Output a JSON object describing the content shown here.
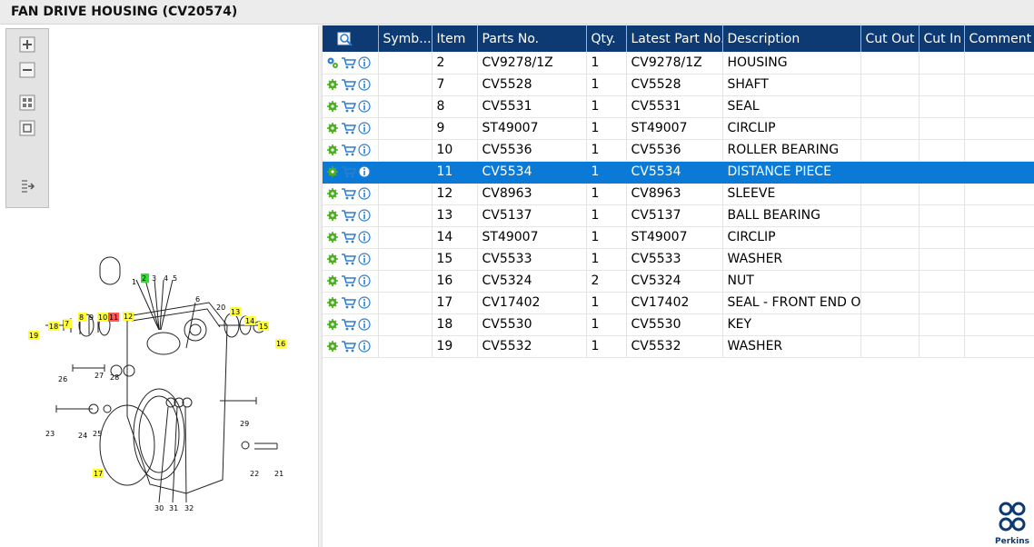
{
  "window": {
    "title": "FAN DRIVE HOUSING (CV20574)"
  },
  "toolbar": {
    "buttons": [
      {
        "name": "zoom-in",
        "icon": "zoom-in-icon"
      },
      {
        "name": "zoom-out",
        "icon": "zoom-out-icon"
      },
      {
        "name": "fit-all",
        "icon": "fit-all-icon"
      },
      {
        "name": "fit-window",
        "icon": "fit-window-icon"
      },
      {
        "name": "export",
        "icon": "export-icon"
      }
    ]
  },
  "grid": {
    "columns": [
      "Symb...",
      "Item",
      "Parts No.",
      "Qty.",
      "Latest Part No.",
      "Description",
      "Cut Out",
      "Cut In",
      "Comment"
    ],
    "header_icon": "search-icon",
    "rows": [
      {
        "item": "2",
        "part_no": "CV9278/1Z",
        "qty": "1",
        "latest": "CV9278/1Z",
        "desc": "HOUSING",
        "cut_out": "",
        "cut_in": "",
        "comment": "",
        "status_icon": "assembly-gears-icon"
      },
      {
        "item": "7",
        "part_no": "CV5528",
        "qty": "1",
        "latest": "CV5528",
        "desc": "SHAFT",
        "cut_out": "",
        "cut_in": "",
        "comment": "",
        "status_icon": "gear-icon"
      },
      {
        "item": "8",
        "part_no": "CV5531",
        "qty": "1",
        "latest": "CV5531",
        "desc": "SEAL",
        "cut_out": "",
        "cut_in": "",
        "comment": "",
        "status_icon": "gear-icon"
      },
      {
        "item": "9",
        "part_no": "ST49007",
        "qty": "1",
        "latest": "ST49007",
        "desc": "CIRCLIP",
        "cut_out": "",
        "cut_in": "",
        "comment": "",
        "status_icon": "gear-icon"
      },
      {
        "item": "10",
        "part_no": "CV5536",
        "qty": "1",
        "latest": "CV5536",
        "desc": "ROLLER BEARING",
        "cut_out": "",
        "cut_in": "",
        "comment": "",
        "status_icon": "gear-icon"
      },
      {
        "item": "11",
        "part_no": "CV5534",
        "qty": "1",
        "latest": "CV5534",
        "desc": "DISTANCE PIECE",
        "cut_out": "",
        "cut_in": "",
        "comment": "",
        "status_icon": "gear-icon",
        "selected": true
      },
      {
        "item": "12",
        "part_no": "CV8963",
        "qty": "1",
        "latest": "CV8963",
        "desc": "SLEEVE",
        "cut_out": "",
        "cut_in": "",
        "comment": "",
        "status_icon": "gear-icon"
      },
      {
        "item": "13",
        "part_no": "CV5137",
        "qty": "1",
        "latest": "CV5137",
        "desc": "BALL BEARING",
        "cut_out": "",
        "cut_in": "",
        "comment": "",
        "status_icon": "gear-icon"
      },
      {
        "item": "14",
        "part_no": "ST49007",
        "qty": "1",
        "latest": "ST49007",
        "desc": "CIRCLIP",
        "cut_out": "",
        "cut_in": "",
        "comment": "",
        "status_icon": "gear-icon"
      },
      {
        "item": "15",
        "part_no": "CV5533",
        "qty": "1",
        "latest": "CV5533",
        "desc": "WASHER",
        "cut_out": "",
        "cut_in": "",
        "comment": "",
        "status_icon": "gear-icon"
      },
      {
        "item": "16",
        "part_no": "CV5324",
        "qty": "2",
        "latest": "CV5324",
        "desc": "NUT",
        "cut_out": "",
        "cut_in": "",
        "comment": "",
        "status_icon": "gear-icon"
      },
      {
        "item": "17",
        "part_no": "CV17402",
        "qty": "1",
        "latest": "CV17402",
        "desc": "SEAL - FRONT END OI",
        "cut_out": "",
        "cut_in": "",
        "comment": "",
        "status_icon": "gear-icon"
      },
      {
        "item": "18",
        "part_no": "CV5530",
        "qty": "1",
        "latest": "CV5530",
        "desc": "KEY",
        "cut_out": "",
        "cut_in": "",
        "comment": "",
        "status_icon": "gear-icon"
      },
      {
        "item": "19",
        "part_no": "CV5532",
        "qty": "1",
        "latest": "CV5532",
        "desc": "WASHER",
        "cut_out": "",
        "cut_in": "",
        "comment": "",
        "status_icon": "gear-icon"
      }
    ]
  },
  "diagram": {
    "callouts": [
      {
        "label": "1",
        "highlight": "none"
      },
      {
        "label": "2",
        "highlight": "green"
      },
      {
        "label": "3",
        "highlight": "none"
      },
      {
        "label": "4",
        "highlight": "none"
      },
      {
        "label": "5",
        "highlight": "none"
      },
      {
        "label": "6",
        "highlight": "none"
      },
      {
        "label": "7",
        "highlight": "yellow"
      },
      {
        "label": "8",
        "highlight": "yellow"
      },
      {
        "label": "9",
        "highlight": "yellow"
      },
      {
        "label": "10",
        "highlight": "yellow"
      },
      {
        "label": "11",
        "highlight": "red"
      },
      {
        "label": "12",
        "highlight": "yellow"
      },
      {
        "label": "13",
        "highlight": "yellow"
      },
      {
        "label": "14",
        "highlight": "yellow"
      },
      {
        "label": "15",
        "highlight": "yellow"
      },
      {
        "label": "16",
        "highlight": "yellow"
      },
      {
        "label": "17",
        "highlight": "yellow"
      },
      {
        "label": "18",
        "highlight": "yellow"
      },
      {
        "label": "19",
        "highlight": "yellow"
      },
      {
        "label": "20",
        "highlight": "none"
      },
      {
        "label": "21",
        "highlight": "none"
      },
      {
        "label": "22",
        "highlight": "none"
      },
      {
        "label": "23",
        "highlight": "none"
      },
      {
        "label": "24",
        "highlight": "none"
      },
      {
        "label": "25",
        "highlight": "none"
      },
      {
        "label": "26",
        "highlight": "none"
      },
      {
        "label": "27",
        "highlight": "none"
      },
      {
        "label": "28",
        "highlight": "none"
      },
      {
        "label": "29",
        "highlight": "none"
      },
      {
        "label": "30",
        "highlight": "none"
      },
      {
        "label": "31",
        "highlight": "none"
      },
      {
        "label": "32",
        "highlight": "none"
      }
    ],
    "highlight_colors": {
      "yellow": "#ffff33",
      "green": "#33dd33",
      "red": "#ff5555"
    }
  },
  "brand": {
    "logo_text": "Perkins",
    "logo_icon": "perkins-logo-icon",
    "color": "#0e3a73"
  },
  "colors": {
    "header_bg": "#0e3a73",
    "selected_row": "#0a7ad6",
    "icon_green": "#4caf20",
    "icon_blue": "#2c7fd0"
  }
}
